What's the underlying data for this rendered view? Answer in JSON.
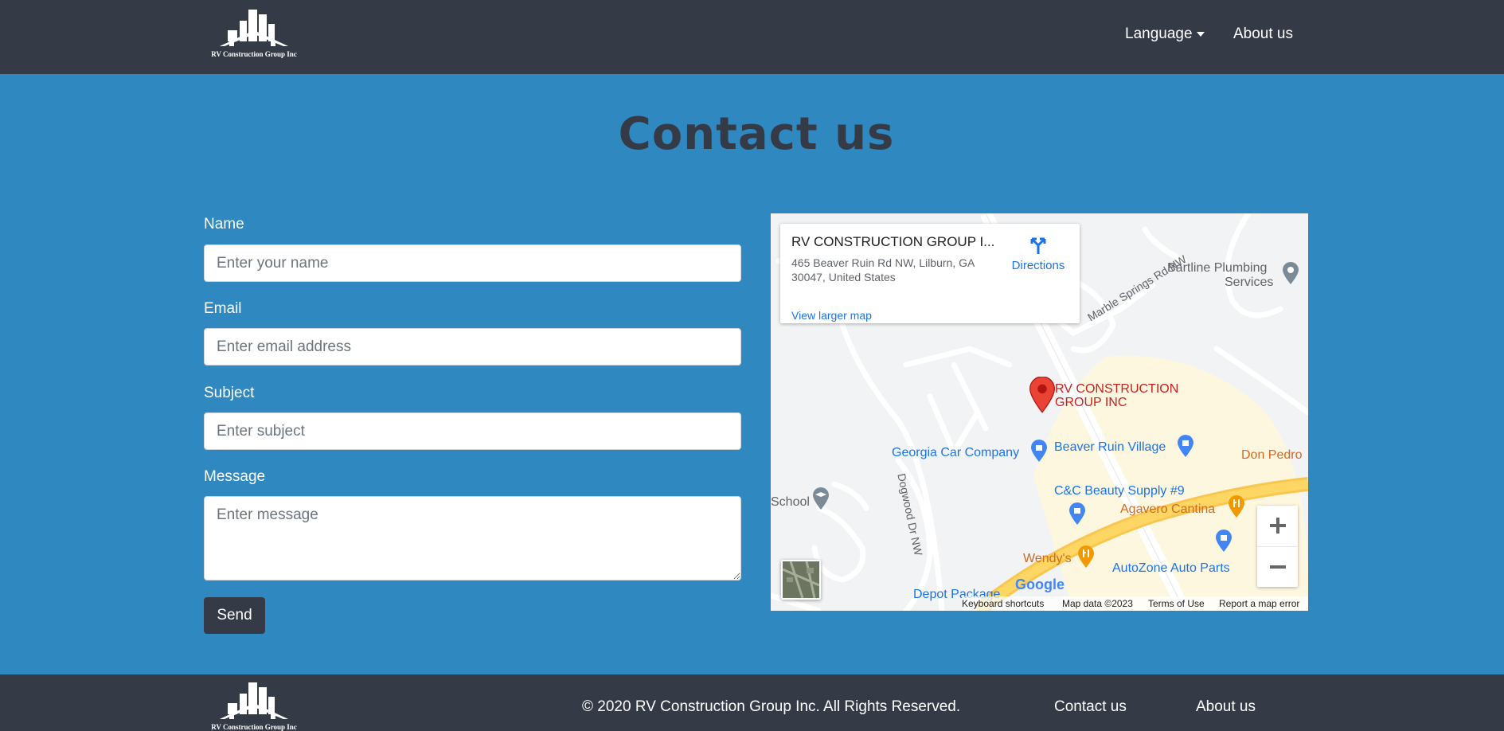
{
  "header": {
    "logo_text": "RV Construction Group Inc",
    "nav": {
      "language_label": "Language",
      "about_label": "About us"
    }
  },
  "page": {
    "title": "Contact us"
  },
  "form": {
    "name": {
      "label": "Name",
      "placeholder": "Enter your name"
    },
    "email": {
      "label": "Email",
      "placeholder": "Enter email address"
    },
    "subject": {
      "label": "Subject",
      "placeholder": "Enter subject"
    },
    "message": {
      "label": "Message",
      "placeholder": "Enter message"
    },
    "send_label": "Send"
  },
  "map": {
    "info_card": {
      "title": "RV CONSTRUCTION GROUP I...",
      "address": "465 Beaver Ruin Rd NW, Lilburn, GA 30047, United States",
      "larger_map_link": "View larger map",
      "directions_label": "Directions"
    },
    "place_labels": {
      "bartline_1": "Bartline Plumbing",
      "bartline_2": "Services",
      "marble_springs": "Marble Springs Rd NW",
      "main_pin_1": "RV CONSTRUCTION",
      "main_pin_2": "GROUP INC",
      "georgia_car": "Georgia Car Company",
      "beaver_ruin": "Beaver Ruin Village",
      "don_pedro": "Don Pedro",
      "school": "School",
      "cc_beauty": "C&C Beauty Supply #9",
      "agavero": "Agavero Cantina",
      "dogwood": "Dogwood Dr NW",
      "wendys": "Wendy's",
      "autozone": "AutoZone Auto Parts",
      "depot": "Depot Package"
    },
    "google_logo": "Google",
    "attribution": {
      "shortcuts": "Keyboard shortcuts",
      "map_data": "Map data ©2023",
      "terms": "Terms of Use",
      "report": "Report a map error"
    },
    "colors": {
      "pin_red": "#ea4335",
      "poi_blue": "#4285f4",
      "poi_orange": "#f29900",
      "highway": "#fdd663",
      "commercial": "#fef7e0"
    }
  },
  "footer": {
    "logo_text": "RV Construction Group Inc",
    "copyright": "© 2020 RV Construction Group Inc. All Rights Reserved.",
    "contact_label": "Contact us",
    "about_label": "About us"
  },
  "colors": {
    "header_bg": "#343a46",
    "page_bg": "#3088c0",
    "button_bg": "#343a46"
  }
}
